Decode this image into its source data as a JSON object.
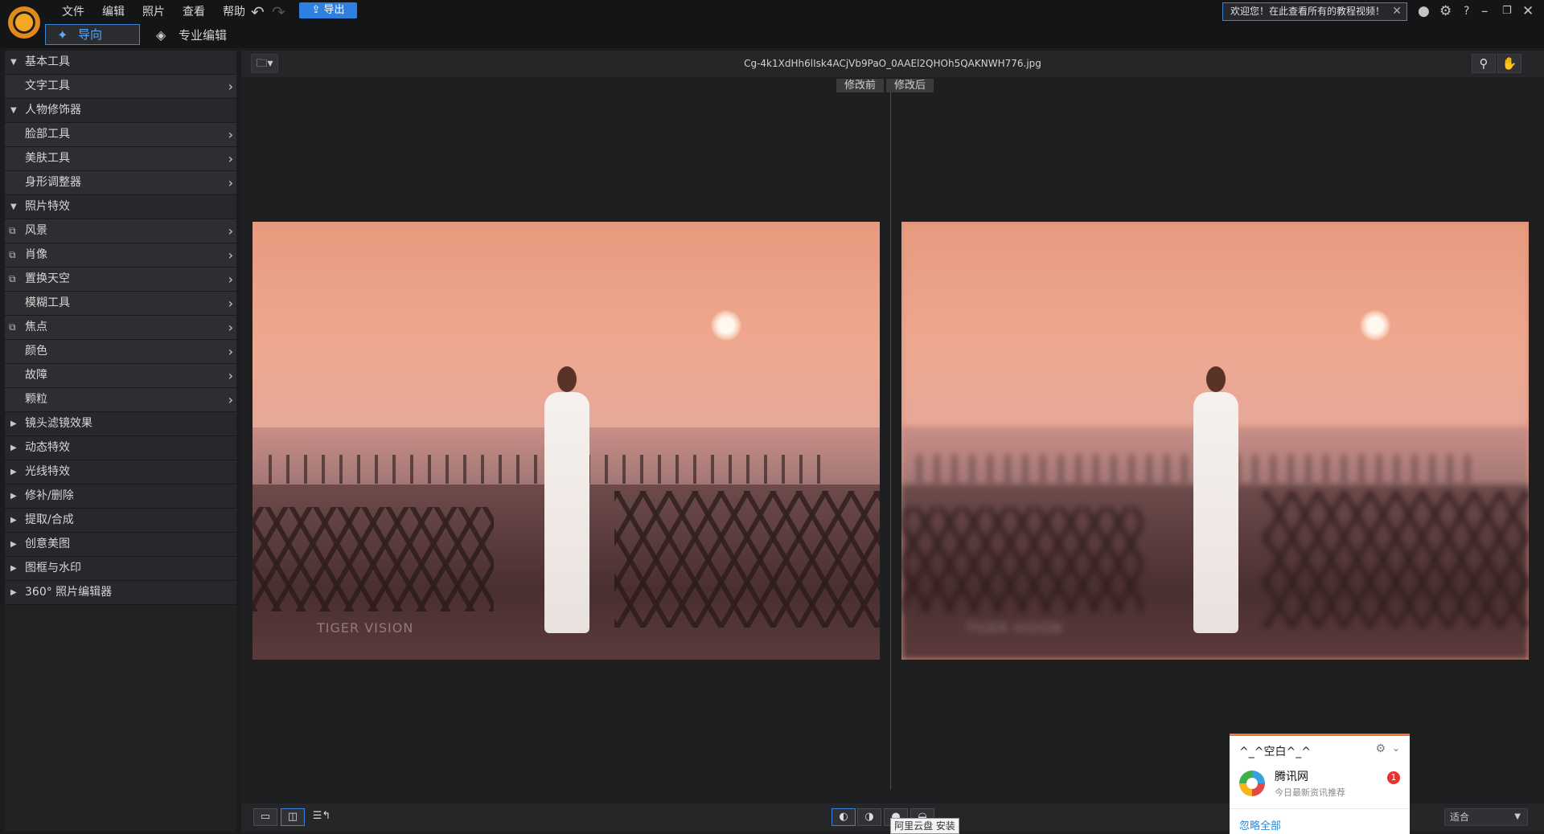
{
  "menu": [
    "文件",
    "编辑",
    "照片",
    "查看",
    "帮助"
  ],
  "toolbar": {
    "export_label": "导出"
  },
  "welcome": {
    "text": "欢迎您！在此查看所有的教程视频！"
  },
  "modes": {
    "guide": "导向",
    "pro": "专业编辑"
  },
  "sidebar": {
    "basic": "基本工具",
    "text_tool": "文字工具",
    "people": "人物修饰器",
    "face": "脸部工具",
    "skin": "美肤工具",
    "body": "身形调整器",
    "effects": "照片特效",
    "scenery": "风景",
    "portrait": "肖像",
    "sky": "置换天空",
    "blur": "模糊工具",
    "focus": "焦点",
    "color": "颜色",
    "glitch": "故障",
    "grain": "颗粒",
    "lens": "镜头滤镜效果",
    "motion": "动态特效",
    "light": "光线特效",
    "repair": "修补/删除",
    "extract": "提取/合成",
    "creative": "创意美图",
    "frames": "图框与水印",
    "panorama": "360° 照片编辑器"
  },
  "viewer": {
    "filename": "Cg-4k1XdHh6lIsk4ACjVb9PaO_0AAEl2QHOh5QAKNWH776.jpg",
    "before": "修改前",
    "after": "修改后",
    "watermark": "TIGER VISION"
  },
  "bottom": {
    "fit": "适合",
    "tooltip": "阿里云盘 安装"
  },
  "notification": {
    "title": "^_^空白^_^",
    "source": "腾讯网",
    "subtitle": "今日最新资讯推荐",
    "badge": "1",
    "ignore": "忽略全部"
  }
}
